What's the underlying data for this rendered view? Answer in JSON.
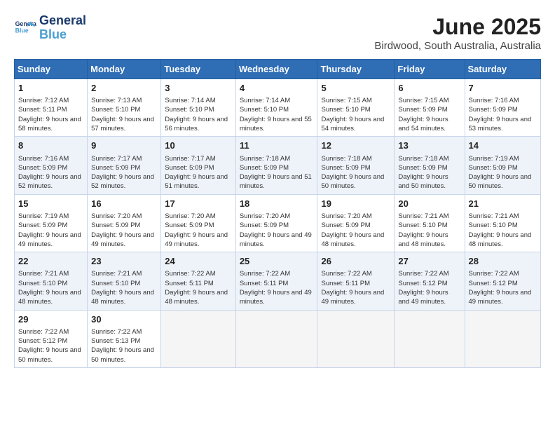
{
  "logo": {
    "line1": "General",
    "line2": "Blue"
  },
  "title": "June 2025",
  "location": "Birdwood, South Australia, Australia",
  "days_of_week": [
    "Sunday",
    "Monday",
    "Tuesday",
    "Wednesday",
    "Thursday",
    "Friday",
    "Saturday"
  ],
  "weeks": [
    [
      {
        "day": "1",
        "sunrise": "7:12 AM",
        "sunset": "5:11 PM",
        "daylight": "9 hours and 58 minutes."
      },
      {
        "day": "2",
        "sunrise": "7:13 AM",
        "sunset": "5:10 PM",
        "daylight": "9 hours and 57 minutes."
      },
      {
        "day": "3",
        "sunrise": "7:14 AM",
        "sunset": "5:10 PM",
        "daylight": "9 hours and 56 minutes."
      },
      {
        "day": "4",
        "sunrise": "7:14 AM",
        "sunset": "5:10 PM",
        "daylight": "9 hours and 55 minutes."
      },
      {
        "day": "5",
        "sunrise": "7:15 AM",
        "sunset": "5:10 PM",
        "daylight": "9 hours and 54 minutes."
      },
      {
        "day": "6",
        "sunrise": "7:15 AM",
        "sunset": "5:09 PM",
        "daylight": "9 hours and 54 minutes."
      },
      {
        "day": "7",
        "sunrise": "7:16 AM",
        "sunset": "5:09 PM",
        "daylight": "9 hours and 53 minutes."
      }
    ],
    [
      {
        "day": "8",
        "sunrise": "7:16 AM",
        "sunset": "5:09 PM",
        "daylight": "9 hours and 52 minutes."
      },
      {
        "day": "9",
        "sunrise": "7:17 AM",
        "sunset": "5:09 PM",
        "daylight": "9 hours and 52 minutes."
      },
      {
        "day": "10",
        "sunrise": "7:17 AM",
        "sunset": "5:09 PM",
        "daylight": "9 hours and 51 minutes."
      },
      {
        "day": "11",
        "sunrise": "7:18 AM",
        "sunset": "5:09 PM",
        "daylight": "9 hours and 51 minutes."
      },
      {
        "day": "12",
        "sunrise": "7:18 AM",
        "sunset": "5:09 PM",
        "daylight": "9 hours and 50 minutes."
      },
      {
        "day": "13",
        "sunrise": "7:18 AM",
        "sunset": "5:09 PM",
        "daylight": "9 hours and 50 minutes."
      },
      {
        "day": "14",
        "sunrise": "7:19 AM",
        "sunset": "5:09 PM",
        "daylight": "9 hours and 50 minutes."
      }
    ],
    [
      {
        "day": "15",
        "sunrise": "7:19 AM",
        "sunset": "5:09 PM",
        "daylight": "9 hours and 49 minutes."
      },
      {
        "day": "16",
        "sunrise": "7:20 AM",
        "sunset": "5:09 PM",
        "daylight": "9 hours and 49 minutes."
      },
      {
        "day": "17",
        "sunrise": "7:20 AM",
        "sunset": "5:09 PM",
        "daylight": "9 hours and 49 minutes."
      },
      {
        "day": "18",
        "sunrise": "7:20 AM",
        "sunset": "5:09 PM",
        "daylight": "9 hours and 49 minutes."
      },
      {
        "day": "19",
        "sunrise": "7:20 AM",
        "sunset": "5:09 PM",
        "daylight": "9 hours and 48 minutes."
      },
      {
        "day": "20",
        "sunrise": "7:21 AM",
        "sunset": "5:10 PM",
        "daylight": "9 hours and 48 minutes."
      },
      {
        "day": "21",
        "sunrise": "7:21 AM",
        "sunset": "5:10 PM",
        "daylight": "9 hours and 48 minutes."
      }
    ],
    [
      {
        "day": "22",
        "sunrise": "7:21 AM",
        "sunset": "5:10 PM",
        "daylight": "9 hours and 48 minutes."
      },
      {
        "day": "23",
        "sunrise": "7:21 AM",
        "sunset": "5:10 PM",
        "daylight": "9 hours and 48 minutes."
      },
      {
        "day": "24",
        "sunrise": "7:22 AM",
        "sunset": "5:11 PM",
        "daylight": "9 hours and 48 minutes."
      },
      {
        "day": "25",
        "sunrise": "7:22 AM",
        "sunset": "5:11 PM",
        "daylight": "9 hours and 49 minutes."
      },
      {
        "day": "26",
        "sunrise": "7:22 AM",
        "sunset": "5:11 PM",
        "daylight": "9 hours and 49 minutes."
      },
      {
        "day": "27",
        "sunrise": "7:22 AM",
        "sunset": "5:12 PM",
        "daylight": "9 hours and 49 minutes."
      },
      {
        "day": "28",
        "sunrise": "7:22 AM",
        "sunset": "5:12 PM",
        "daylight": "9 hours and 49 minutes."
      }
    ],
    [
      {
        "day": "29",
        "sunrise": "7:22 AM",
        "sunset": "5:12 PM",
        "daylight": "9 hours and 50 minutes."
      },
      {
        "day": "30",
        "sunrise": "7:22 AM",
        "sunset": "5:13 PM",
        "daylight": "9 hours and 50 minutes."
      },
      null,
      null,
      null,
      null,
      null
    ]
  ]
}
